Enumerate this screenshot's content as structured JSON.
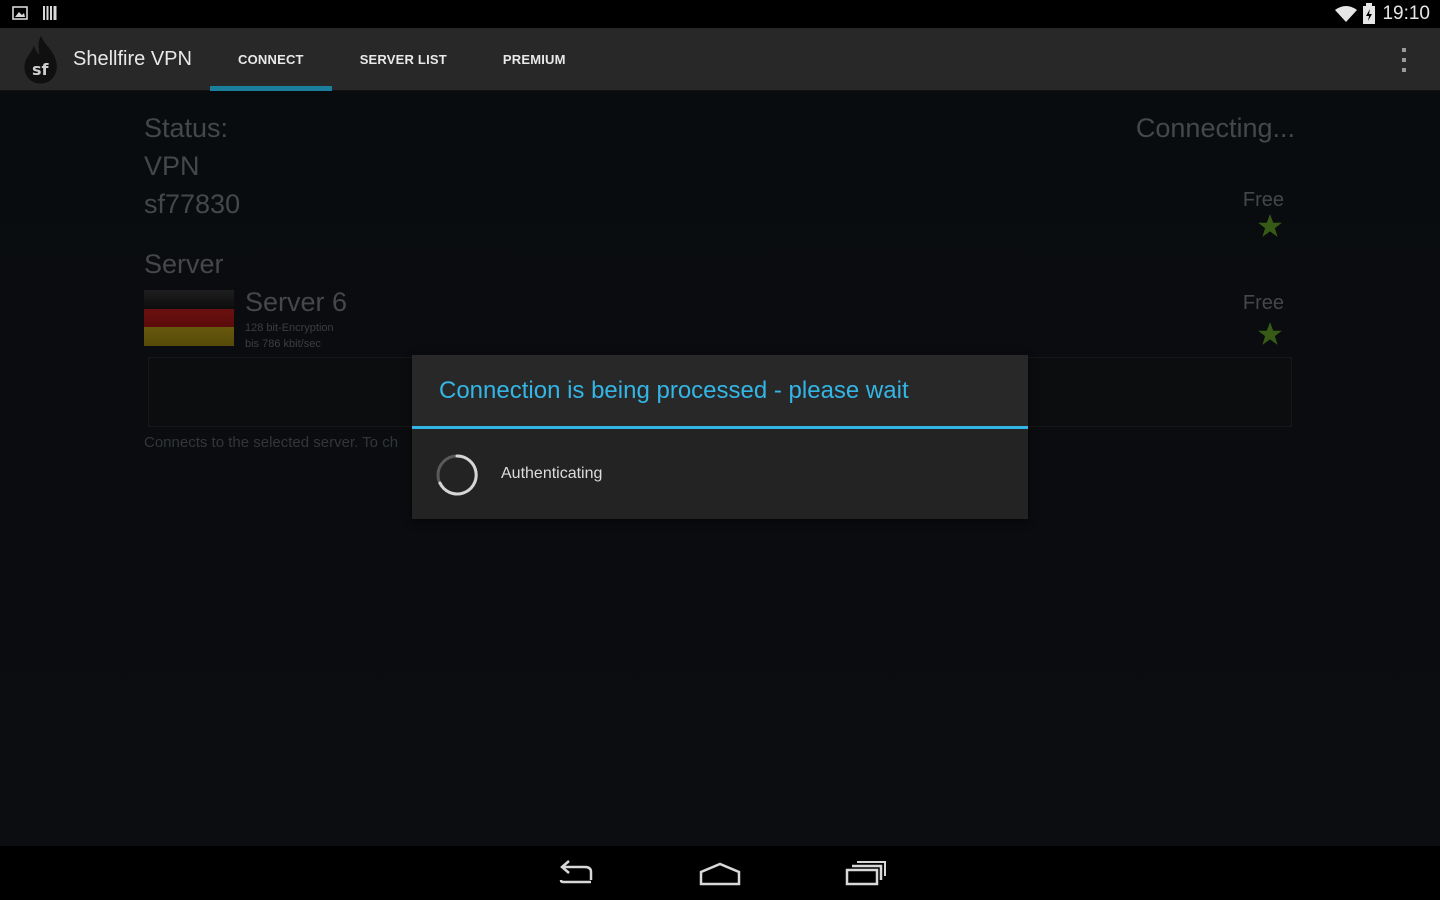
{
  "status_bar": {
    "time": "19:10",
    "left_icons": [
      "image-notification-icon",
      "barcode-notification-icon"
    ],
    "right_icons": [
      "wifi-icon",
      "battery-charging-icon"
    ]
  },
  "action_bar": {
    "app_title": "Shellfire VPN",
    "tabs": [
      {
        "label": "CONNECT",
        "active": true
      },
      {
        "label": "SERVER LIST",
        "active": false
      },
      {
        "label": "PREMIUM",
        "active": false
      }
    ],
    "accent_color": "#1b7e9c"
  },
  "connect": {
    "status_label": "Status:",
    "status_value": "Connecting...",
    "vpn_label": "VPN",
    "vpn_user": "sf77830",
    "vpn_tier": "Free",
    "server_heading": "Server",
    "server_name": "Server 6",
    "server_encryption": "128 bit-Encryption",
    "server_speed": "bis 786 kbit/sec",
    "server_tier": "Free",
    "server_country_flag": "germany-flag",
    "hint_text": "Connects to the selected server. To ch"
  },
  "dialog": {
    "title": "Connection is being processed - please wait",
    "message": "Authenticating",
    "accent_color": "#33b5e5"
  },
  "nav_bar": {
    "buttons": [
      "back-icon",
      "home-icon",
      "recent-apps-icon"
    ]
  }
}
